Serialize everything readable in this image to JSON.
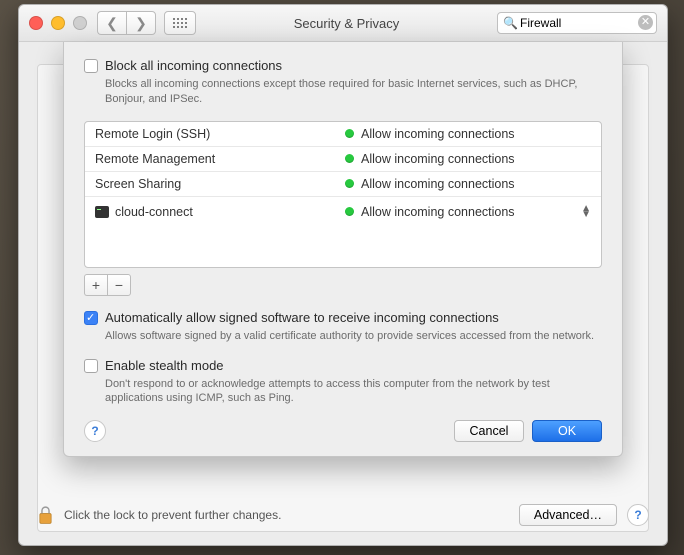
{
  "window": {
    "title": "Security & Privacy",
    "search_value": "Firewall"
  },
  "sheet": {
    "block_all": {
      "label": "Block all incoming connections",
      "desc": "Blocks all incoming connections except those required for basic Internet services,  such as DHCP, Bonjour, and IPSec."
    },
    "services": [
      {
        "name": "Remote Login (SSH)",
        "status": "Allow incoming connections"
      },
      {
        "name": "Remote Management",
        "status": "Allow incoming connections"
      },
      {
        "name": "Screen Sharing",
        "status": "Allow incoming connections"
      }
    ],
    "apps": [
      {
        "name": "cloud-connect",
        "status": "Allow incoming connections"
      }
    ],
    "auto_allow": {
      "label": "Automatically allow signed software to receive incoming connections",
      "desc": "Allows software signed by a valid certificate authority to provide services accessed from the network."
    },
    "stealth": {
      "label": "Enable stealth mode",
      "desc": "Don't respond to or acknowledge attempts to access this computer from the network by test applications using ICMP, such as Ping."
    },
    "buttons": {
      "cancel": "Cancel",
      "ok": "OK"
    }
  },
  "footer": {
    "lock_text": "Click the lock to prevent further changes.",
    "advanced": "Advanced…"
  }
}
